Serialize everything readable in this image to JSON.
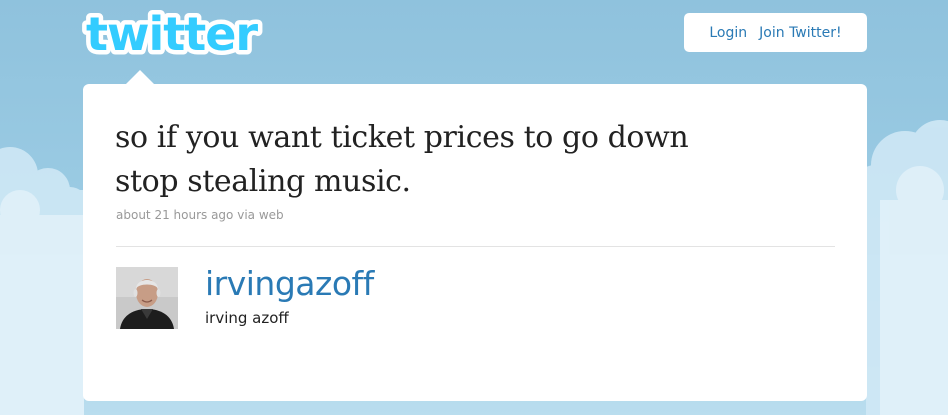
{
  "logo": {
    "text": "twitter"
  },
  "nav": {
    "login_label": "Login",
    "join_label": "Join Twitter!"
  },
  "tweet": {
    "text_line1": "so if you want ticket prices to go down",
    "text_line2": "stop stealing music.",
    "timestamp": "about 21 hours ago",
    "via_prefix": "via",
    "source": "web"
  },
  "author": {
    "screen_name": "irvingazoff",
    "full_name": "irving azoff"
  },
  "colors": {
    "background": "#92c4de",
    "link": "#2a7ab5",
    "logo_fill": "#33ccff",
    "card": "#ffffff",
    "meta_text": "#999999"
  }
}
